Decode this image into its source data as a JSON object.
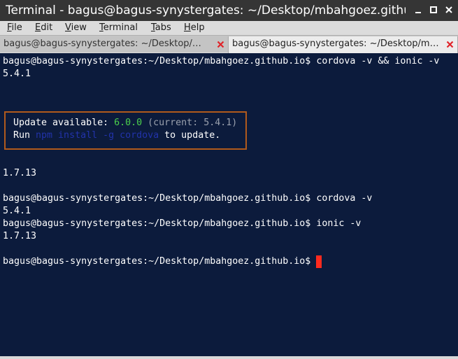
{
  "window": {
    "title": "Terminal - bagus@bagus-synystergates: ~/Desktop/mbahgoez.github.io"
  },
  "menu": {
    "items": [
      {
        "label": "File",
        "key": "F",
        "rest": "ile"
      },
      {
        "label": "Edit",
        "key": "E",
        "rest": "dit"
      },
      {
        "label": "View",
        "key": "V",
        "rest": "iew"
      },
      {
        "label": "Terminal",
        "key": "T",
        "rest": "erminal"
      },
      {
        "label": "Tabs",
        "key": "T",
        "rest": "abs"
      },
      {
        "label": "Help",
        "key": "H",
        "rest": "elp"
      }
    ]
  },
  "tabs": [
    {
      "label": "bagus@bagus-synystergates: ~/Desktop/…",
      "active": false
    },
    {
      "label": "bagus@bagus-synystergates: ~/Desktop/m…",
      "active": true
    }
  ],
  "terminal": {
    "prompt": "bagus@bagus-synystergates:~/Desktop/mbahgoez.github.io$ ",
    "lines": {
      "cmd1": "cordova -v && ionic -v",
      "out1": "5.4.1",
      "out2": "1.7.13",
      "cmd2": "cordova -v",
      "out3": "5.4.1",
      "cmd3": "ionic -v",
      "out4": "1.7.13"
    },
    "update": {
      "prefix": "Update available: ",
      "version": "6.0.0",
      "current": " (current: 5.4.1)",
      "run": "Run ",
      "command": "npm install -g cordova",
      "suffix": " to update."
    }
  },
  "colors": {
    "terminal_bg": "#0c1b3c",
    "box_border": "#b15a1c",
    "version_green": "#4cd14c",
    "cursor": "#ff2a1e",
    "close_red": "#e0242a"
  }
}
